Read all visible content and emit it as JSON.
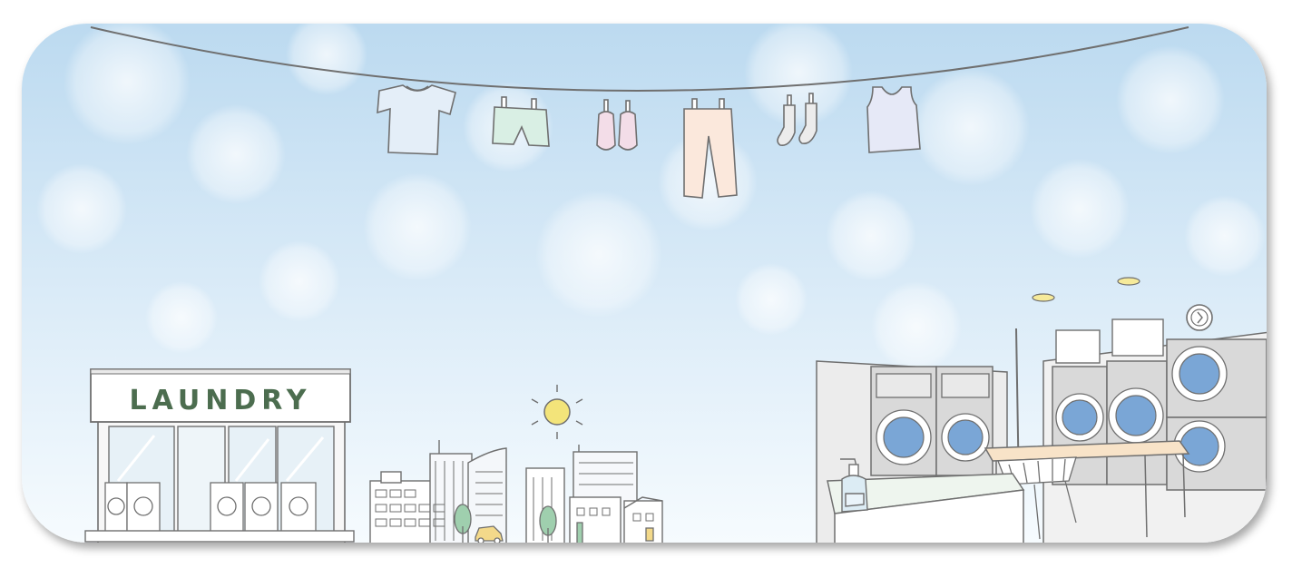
{
  "store": {
    "sign_text": "LAUNDRY"
  },
  "colors": {
    "sky_top": "#bfdcf0",
    "sky_bottom": "#f3f9fd",
    "line": "#6f6f6f",
    "sign_text": "#4c6d4f",
    "machine_body": "#d7d7d7",
    "drum": "#7aa6d6",
    "sun": "#f3e47a",
    "table_top": "#f8e3c8"
  },
  "icons": {
    "clothesline": "clothesline",
    "tshirt": "tshirt-icon",
    "shorts": "shorts-icon",
    "shoes": "shoes-icon",
    "pants": "pants-icon",
    "socks": "socks-icon",
    "tank_top": "tank-top-icon",
    "sun": "sun-icon",
    "wall_clock": "clock-icon",
    "soap_bottle": "soap-bottle-icon",
    "laundry_basket": "laundry-basket-icon"
  }
}
